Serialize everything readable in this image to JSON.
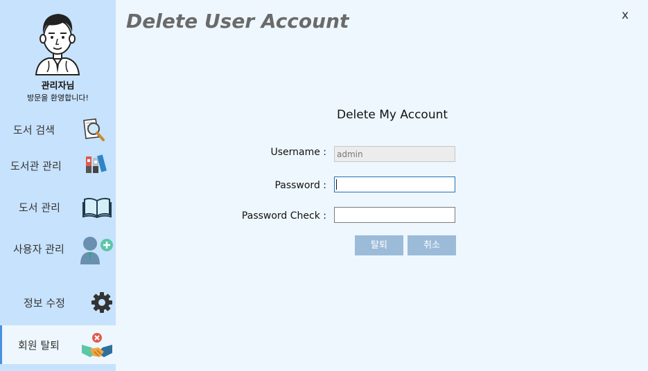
{
  "sidebar": {
    "user_name": "관리자님",
    "greeting": "방문을 환영합니다!",
    "items": [
      {
        "label": "도서 검색",
        "icon": "magnifier-book-icon"
      },
      {
        "label": "도서관 관리",
        "icon": "binders-icon"
      },
      {
        "label": "도서 관리",
        "icon": "open-book-icon"
      },
      {
        "label": "사용자 관리",
        "icon": "add-user-icon"
      },
      {
        "label": "정보 수정",
        "icon": "gear-icon"
      },
      {
        "label": "회원 탈퇴",
        "icon": "handshake-remove-icon"
      }
    ],
    "active_item": "회원 탈퇴",
    "colors": {
      "background": "#c7e2fc",
      "active": "#eef7fe",
      "indicator": "#4a90e2"
    }
  },
  "header": {
    "title": "Delete User Account",
    "close_label": "x"
  },
  "form": {
    "heading": "Delete My Account",
    "username_label": "Username :",
    "username_value": "admin",
    "password_label": "Password :",
    "password_value": "",
    "password_check_label": "Password Check :",
    "password_check_value": "",
    "submit_label": "탈퇴",
    "cancel_label": "취소",
    "button_color": "#9bbbd8"
  }
}
